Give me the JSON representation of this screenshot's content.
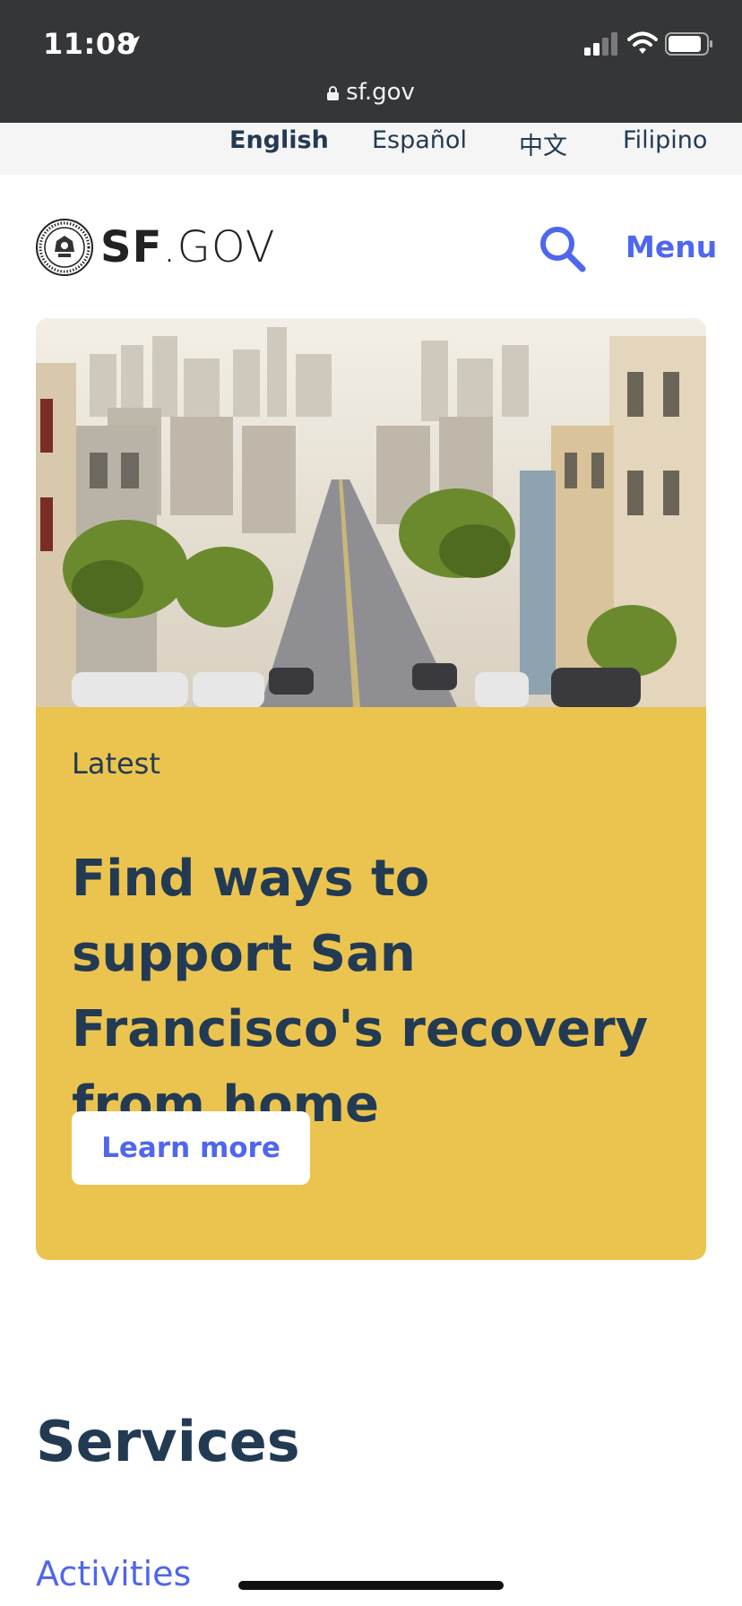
{
  "status_bar": {
    "time": "11:08",
    "url": "sf.gov"
  },
  "languages": [
    "English",
    "Español",
    "中文",
    "Filipino"
  ],
  "header": {
    "logo_bold": "SF",
    "logo_light": ".GOV",
    "menu_label": "Menu"
  },
  "hero": {
    "tag": "Latest",
    "title": "Find ways to support San Francisco's recovery from home",
    "button_label": "Learn more"
  },
  "services": {
    "title": "Services",
    "first_item": "Activities"
  },
  "colors": {
    "accent": "#4f66ee",
    "navy": "#233a53",
    "hero_bg": "#ebc450",
    "status_bg": "#353638"
  }
}
